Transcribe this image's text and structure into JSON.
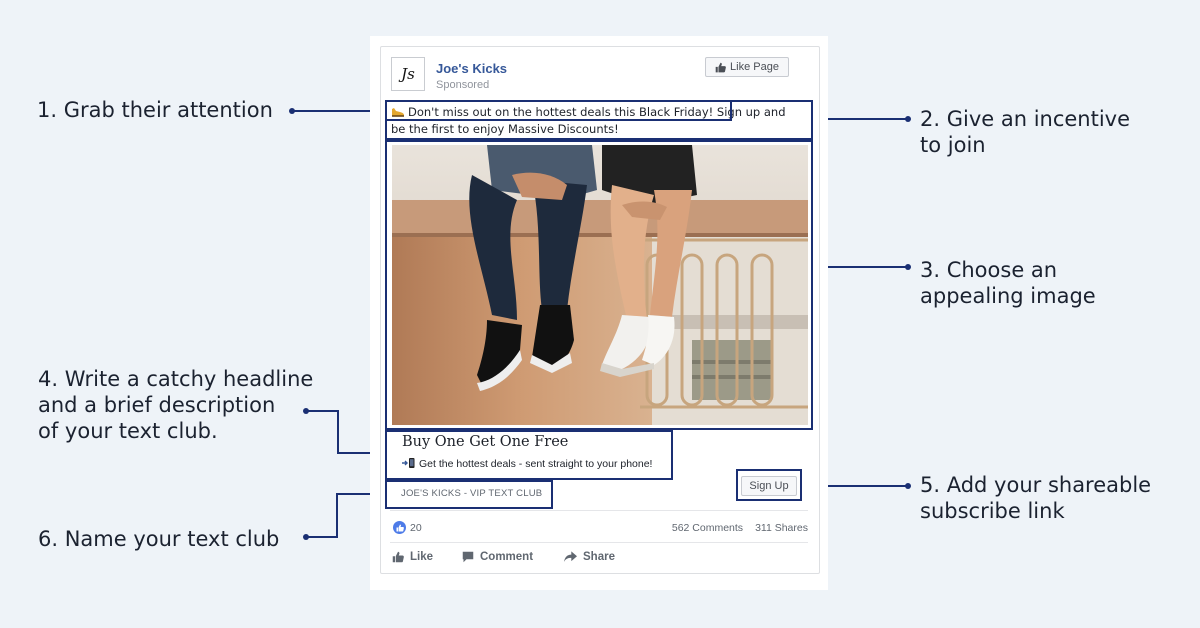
{
  "post": {
    "page_name": "Joe's Kicks",
    "logo_text": "Js",
    "sponsored": "Sponsored",
    "like_page_label": "Like Page",
    "text_line1_boxed": "Don't miss out on the hottest deals this Black Friday!",
    "text_line1_rest": "Sign up and",
    "text_line2": "be the first to enjoy Massive Discounts!",
    "headline": "Buy One Get One Free",
    "description": "Get the hottest deals - sent straight to your phone!",
    "club_name": "JOE'S KICKS - VIP TEXT CLUB",
    "cta_label": "Sign Up",
    "reaction_count": "20",
    "comments": "562 Comments",
    "shares": "311 Shares",
    "actions": {
      "like": "Like",
      "comment": "Comment",
      "share": "Share"
    }
  },
  "annotations": {
    "a1": "1. Grab their attention",
    "a2": "2. Give an incentive\nto join",
    "a3": "3. Choose an\nappealing image",
    "a4": "4. Write a catchy headline\nand a brief description\nof your text club.",
    "a5": "5. Add your shareable\nsubscribe link",
    "a6": "6. Name your text club"
  },
  "colors": {
    "accent": "#1a2f73",
    "link": "#365899",
    "background": "#eef3f8"
  }
}
